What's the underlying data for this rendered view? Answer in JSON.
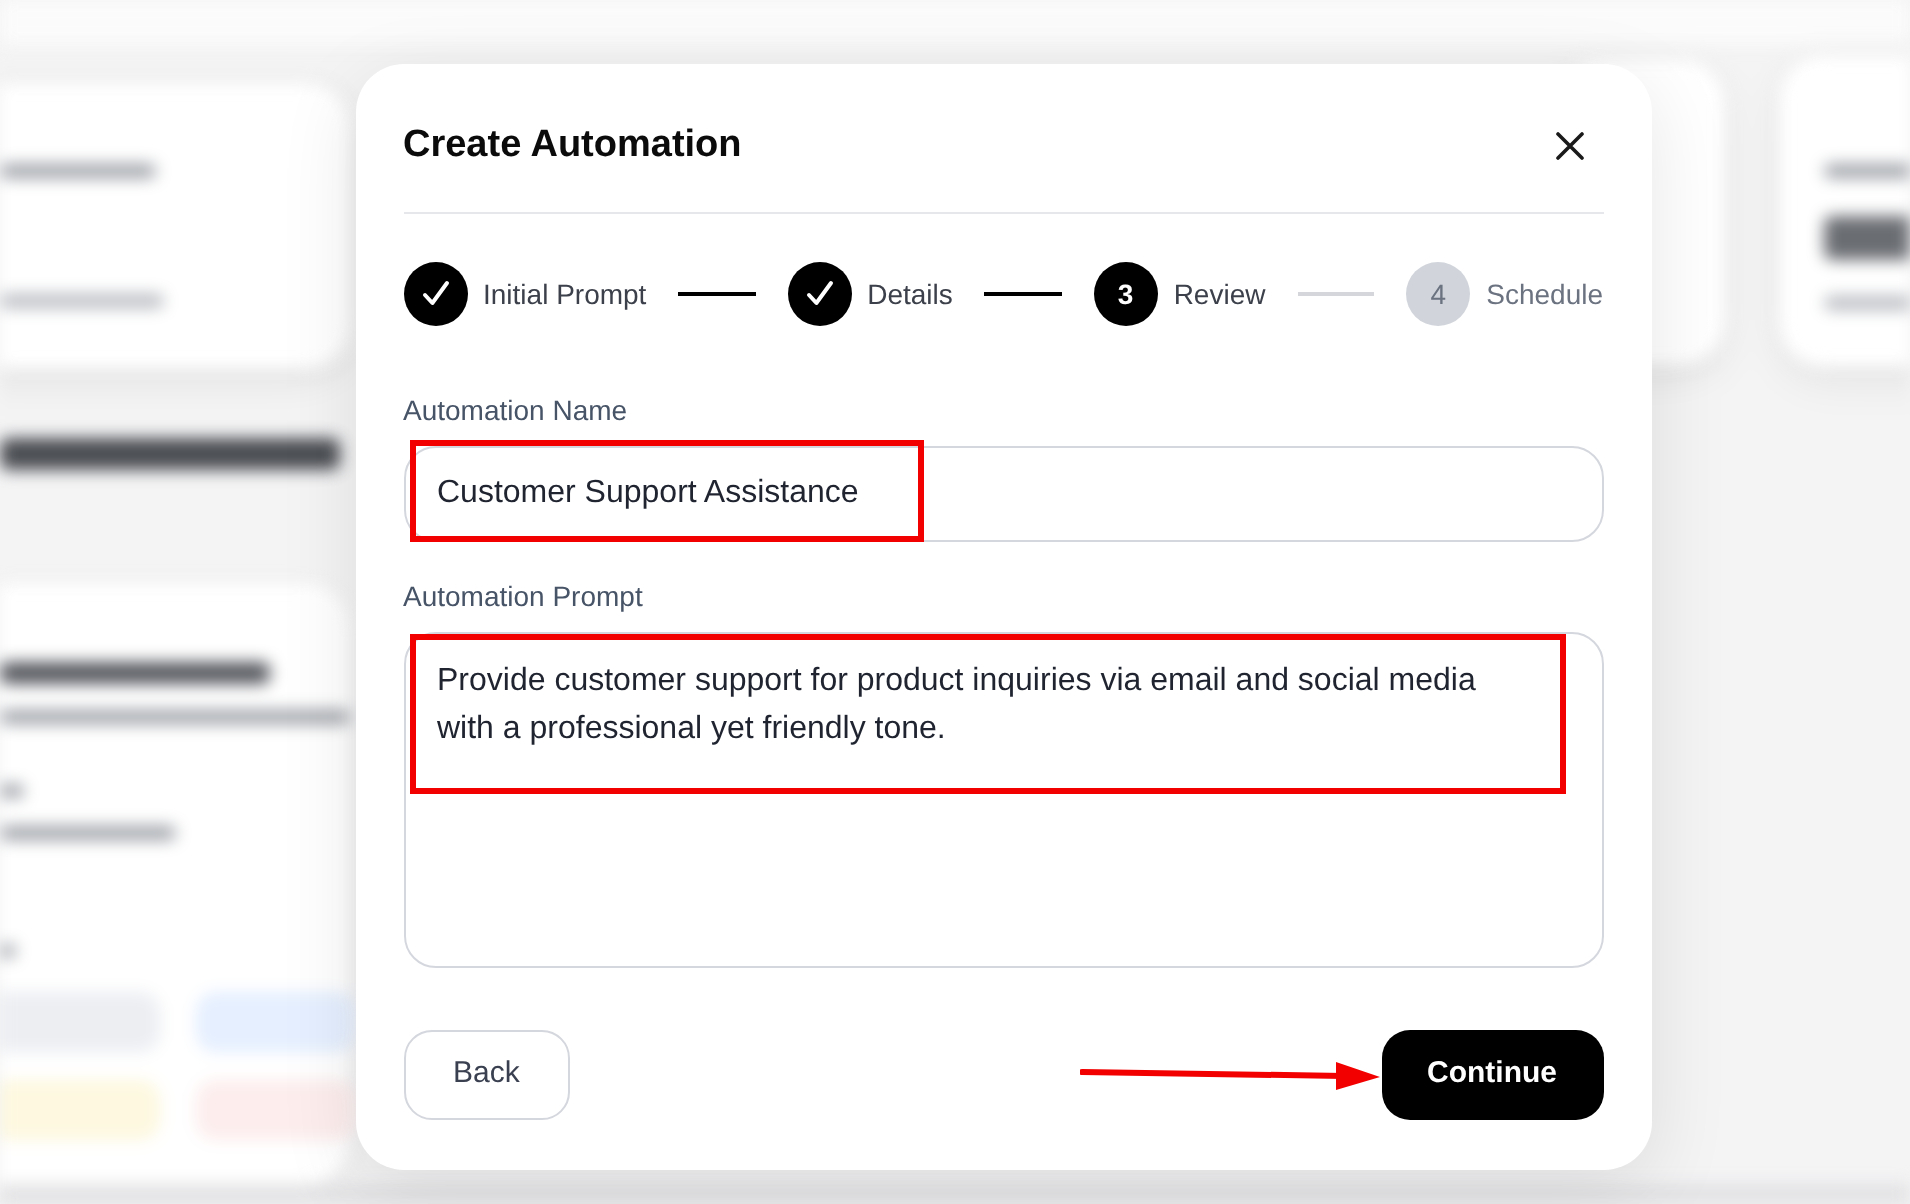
{
  "dialog": {
    "title": "Create Automation"
  },
  "steps": [
    {
      "label": "Initial Prompt",
      "completed": true,
      "selected": false
    },
    {
      "label": "Details",
      "completed": true,
      "selected": false
    },
    {
      "label": "Review",
      "number": "3",
      "completed": false,
      "selected": true
    },
    {
      "label": "Schedule",
      "number": "4",
      "completed": false,
      "selected": false
    }
  ],
  "fields": [
    {
      "kind": "input",
      "label": "Automation Name",
      "value": "Customer Support Assistance",
      "highlighted": true
    },
    {
      "kind": "textarea",
      "label": "Automation Prompt",
      "value": "Provide customer support for product inquiries via email and social media with a professional yet friendly tone.",
      "highlighted": true
    }
  ],
  "buttons": [
    {
      "kind": "secondary",
      "label": "Back",
      "pointed": false
    },
    {
      "kind": "primary",
      "label": "Continue",
      "pointed": true
    }
  ]
}
